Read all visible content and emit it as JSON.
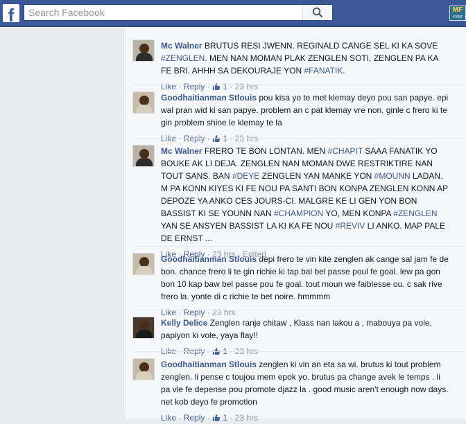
{
  "header": {
    "logo": "f",
    "search_placeholder": "Search Facebook",
    "badge_title": "MF",
    "badge_sub": "479NF"
  },
  "comments": [
    {
      "author": "Mc Walner",
      "lines": [
        [
          {
            "t": " BRUTUS RESI JWENN. REGINALD CANGE SEL KI KA SOVE"
          }
        ],
        [
          {
            "t": "#ZENGLEN",
            "h": true
          },
          {
            "t": ". MEN NAN MOMAN PLAK ZENGLEN SOTI, ZENGLEN PA KA"
          }
        ],
        [
          {
            "t": "FE BRI. AHHH SA DEKOURAJE YON "
          },
          {
            "t": "#FANATIK",
            "h": true
          },
          {
            "t": "."
          }
        ]
      ],
      "like": "Like",
      "reply": "Reply",
      "likes": "1",
      "time": "23 hrs",
      "edited": ""
    },
    {
      "author": "Goodhaitianman Stlouis",
      "lines": [
        [
          {
            "t": " pou kisa yo te met klemay deyo pou san papye. epi"
          }
        ],
        [
          {
            "t": "wal pran wid ki san papye. problem an c pat klemay vre non. ginle c frero ki te"
          }
        ],
        [
          {
            "t": "gin problem shine le klemay te la"
          }
        ]
      ],
      "like": "Like",
      "reply": "Reply",
      "likes": "1",
      "time": "23 hrs",
      "edited": ""
    },
    {
      "author": "Mc Walner",
      "lines": [
        [
          {
            "t": " FRERO TE BON LONTAN. MEN "
          },
          {
            "t": "#CHAPIT",
            "h": true
          },
          {
            "t": " SAAA FANATIK YO"
          }
        ],
        [
          {
            "t": "BOUKE AK LI DEJA. ZENGLEN NAN MOMAN DWE RESTRIKTIRE NAN"
          }
        ],
        [
          {
            "t": "TOUT SANS. BAN "
          },
          {
            "t": "#DEYE",
            "h": true
          },
          {
            "t": " ZENGLEN YAN MANKE YON "
          },
          {
            "t": "#MOUNN",
            "h": true
          },
          {
            "t": " LADAN."
          }
        ],
        [
          {
            "t": "M PA KONN KIYES KI FE NOU PA SANTI BON KONPA ZENGLEN KONN AP"
          }
        ],
        [
          {
            "t": "DEPOZE YA ANKO CES JOURS-CI. MALGRE KE LI GEN YON BON"
          }
        ],
        [
          {
            "t": "BASSIST KI SE YOUNN NAN "
          },
          {
            "t": "#CHAMPION",
            "h": true
          },
          {
            "t": " YO, MEN KONPA "
          },
          {
            "t": "#ZENGLEN",
            "h": true
          }
        ],
        [
          {
            "t": "YAN SE ANSYEN BASSIST LA KI KA FE NOU "
          },
          {
            "t": "#REVIV",
            "h": true
          },
          {
            "t": " LI ANKO. MAP PALE"
          }
        ],
        [
          {
            "t": "DE ERNST ..."
          }
        ]
      ],
      "like": "Like",
      "reply": "Reply",
      "likes": "",
      "time": "23 hrs",
      "edited": "Edited"
    },
    {
      "author": "Goodhaitianman Stlouis",
      "lines": [
        [
          {
            "t": " depi frero te vin kite zenglen ak cange sal jam fe de"
          }
        ],
        [
          {
            "t": "bon. chance frero li te gin richie ki tap bal bel passe poul fe goal. lew pa gon"
          }
        ],
        [
          {
            "t": "bon 10 kap baw bel passe pou fe goal. tout moun we faiblesse ou. c sak rive"
          }
        ],
        [
          {
            "t": "frero la. yonte di c richie te bet noire. hmmmm"
          }
        ]
      ],
      "like": "Like",
      "reply": "Reply",
      "likes": "",
      "time": "23 hrs",
      "edited": ""
    },
    {
      "author": "Kelly Delice",
      "lines": [
        [
          {
            "t": " Zenglen ranje chitaw , Klass nan lakou a , mabouya pa vole,"
          }
        ],
        [
          {
            "t": "papiyon ki vole, yaya flay!!"
          }
        ]
      ],
      "like": "Like",
      "reply": "Reply",
      "likes": "1",
      "time": "23 hrs",
      "edited": ""
    },
    {
      "author": "Goodhaitianman Stlouis",
      "lines": [
        [
          {
            "t": " zenglen ki vin an eta sa wi. brutus ki tout problem"
          }
        ],
        [
          {
            "t": "zenglen. li pense c toujou mem epok yo. brutus pa change avek le temps . li"
          }
        ],
        [
          {
            "t": "pa vle fe depense pou promote djazz la . good music aren't enough now days."
          }
        ],
        [
          {
            "t": "net kob deyo fe promotion"
          }
        ]
      ],
      "like": "Like",
      "reply": "Reply",
      "likes": "1",
      "time": "23 hrs",
      "edited": ""
    }
  ]
}
